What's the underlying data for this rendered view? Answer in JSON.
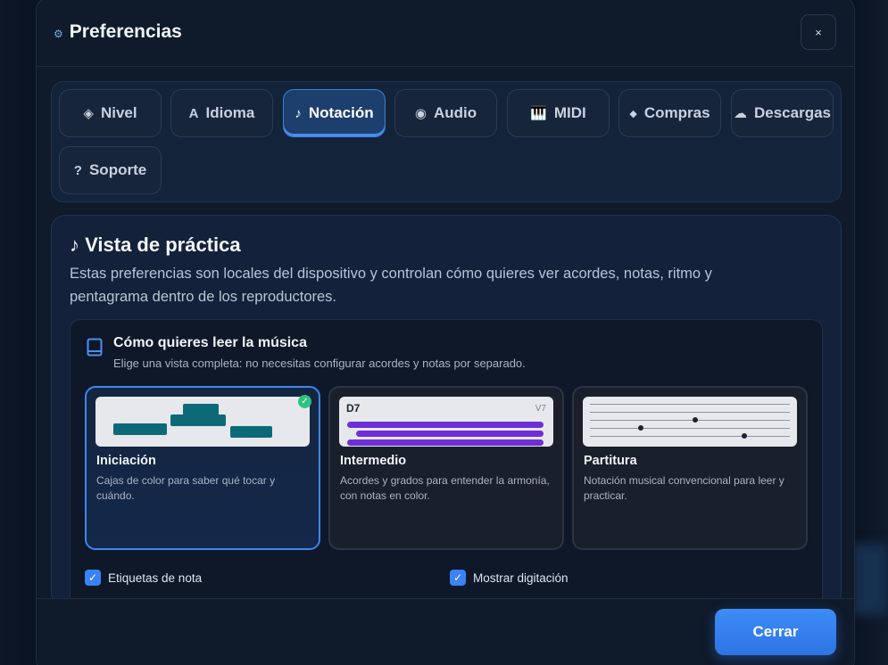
{
  "dialog": {
    "title": "Preferencias",
    "icon": "gear-icon",
    "close_label": "×"
  },
  "tabs": [
    {
      "label": "Nivel",
      "icon": "◈",
      "active": false
    },
    {
      "label": "Idioma",
      "icon": "A",
      "active": false
    },
    {
      "label": "Notación",
      "icon": "♪",
      "active": true
    },
    {
      "label": "Audio",
      "icon": "◉",
      "active": false
    },
    {
      "label": "MIDI",
      "icon": "🎹",
      "active": false
    },
    {
      "label": "Compras",
      "icon": "◆",
      "active": false
    },
    {
      "label": "Descargas",
      "icon": "☁",
      "active": false
    },
    {
      "label": "Soporte",
      "icon": "?",
      "active": false
    }
  ],
  "section": {
    "icon": "♪",
    "title": "Vista de práctica",
    "description": "Estas preferencias son locales del dispositivo y controlan cómo quieres ver acordes, notas, ritmo y pentagrama dentro de los reproductores."
  },
  "reading": {
    "title": "Cómo quieres leer la música",
    "subtitle": "Elige una vista completa: no necesitas configurar acordes y notas por separado.",
    "options": [
      {
        "name": "Iniciación",
        "description": "Cajas de color para saber qué tocar y cuándo.",
        "selected": true
      },
      {
        "name": "Intermedio",
        "description": "Acordes y grados para entender la armonía, con notas en color.",
        "selected": false,
        "chord": "D7",
        "degree": "V7"
      },
      {
        "name": "Partitura",
        "description": "Notación musical convencional para leer y practicar.",
        "selected": false
      }
    ]
  },
  "checkboxes": [
    {
      "label": "Etiquetas de nota",
      "checked": true
    },
    {
      "label": "Mostrar digitación",
      "checked": true
    }
  ],
  "footer": {
    "close_button": "Cerrar"
  },
  "colors": {
    "accent": "#3b82f6",
    "selected_badge": "#2ec27e",
    "block": "#0c6a78",
    "bar": "#6d2fd6"
  }
}
